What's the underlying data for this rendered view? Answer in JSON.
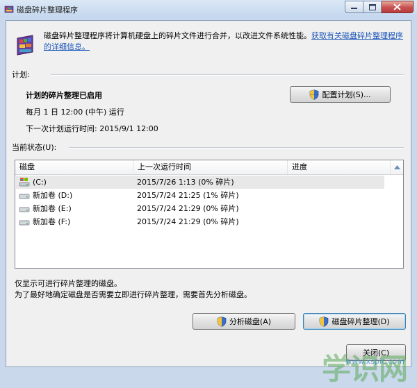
{
  "window": {
    "title": "磁盘碎片整理程序"
  },
  "description": {
    "text": "磁盘碎片整理程序将计算机硬盘上的碎片文件进行合并，以改进文件系统性能。",
    "link": "获取有关磁盘碎片整理程序的详细信息。"
  },
  "schedule": {
    "label": "计划:",
    "status": "计划的碎片整理已启用",
    "frequency": "每月 1 日 12:00 (中午) 运行",
    "next_run": "下一次计划运行时间: 2015/9/1 12:00",
    "configure_button": "配置计划(S)..."
  },
  "current_status": {
    "label": "当前状态(U):",
    "columns": [
      "磁盘",
      "上一次运行时间",
      "进度"
    ],
    "rows": [
      {
        "disk": "(C:)",
        "last_run": "2015/7/26 1:13 (0% 碎片)",
        "progress": ""
      },
      {
        "disk": "新加卷 (D:)",
        "last_run": "2015/7/24 21:25 (1% 碎片)",
        "progress": ""
      },
      {
        "disk": "新加卷 (E:)",
        "last_run": "2015/7/24 21:29 (0% 碎片)",
        "progress": ""
      },
      {
        "disk": "新加卷 (F:)",
        "last_run": "2015/7/24 21:29 (0% 碎片)",
        "progress": ""
      }
    ]
  },
  "notes": {
    "line1": "仅显示可进行碎片整理的磁盘。",
    "line2": "为了最好地确定磁盘是否需要立即进行碎片整理，需要首先分析磁盘。"
  },
  "actions": {
    "analyze_button": "分析磁盘(A)",
    "defrag_button": "磁盘碎片整理(D)",
    "close_button": "关闭(C)"
  },
  "watermark": {
    "main": "学识网",
    "sub": "www.xspic.com"
  },
  "colors": {
    "link": "#1a55b8",
    "titlebar": "#c4d7ee",
    "close_button": "#c75050"
  }
}
